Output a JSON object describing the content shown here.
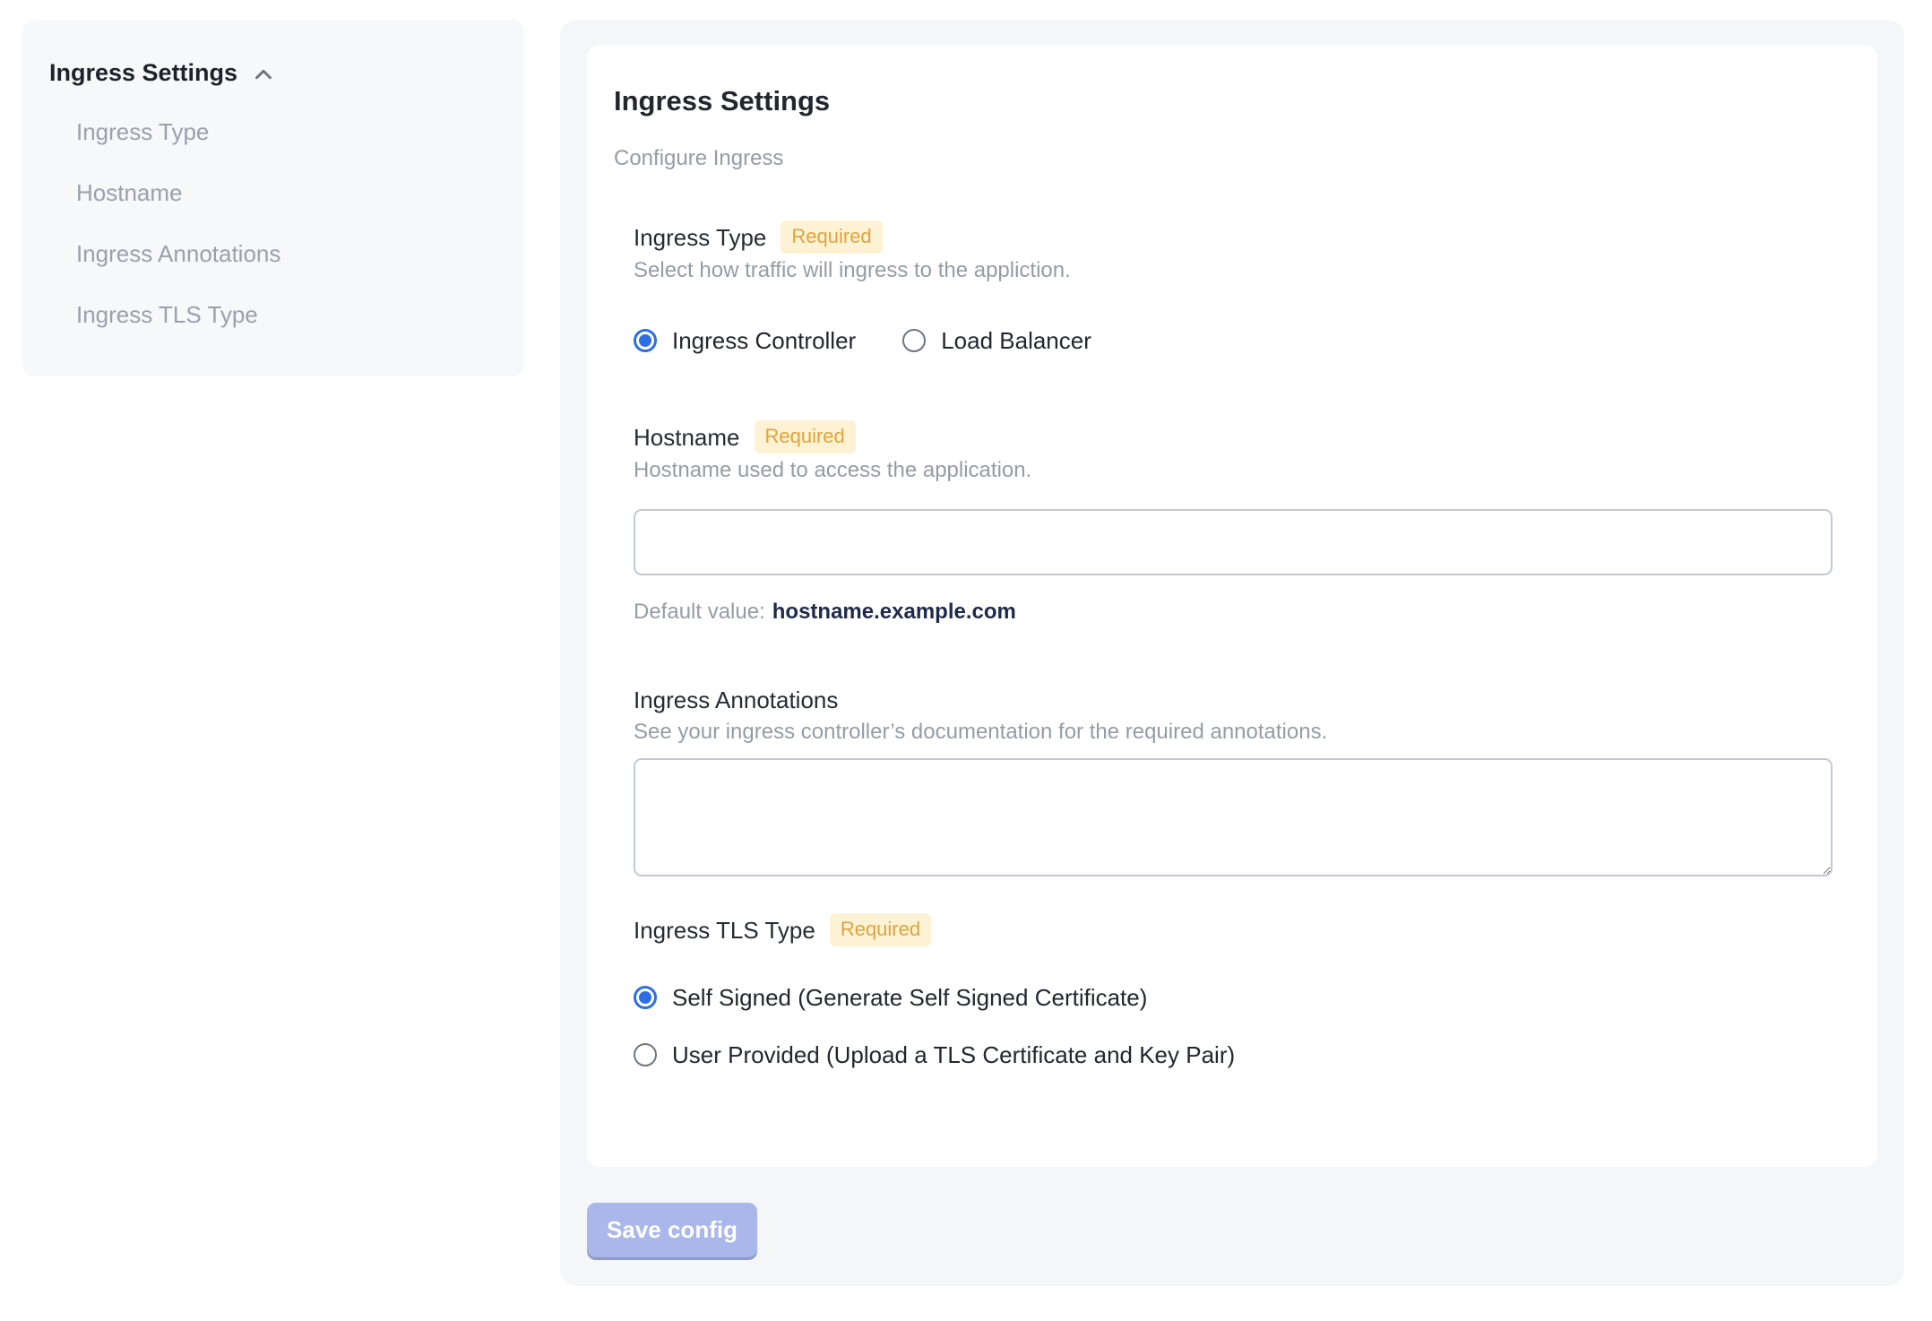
{
  "sidebar": {
    "header": "Ingress Settings",
    "items": [
      {
        "label": "Ingress Type"
      },
      {
        "label": "Hostname"
      },
      {
        "label": "Ingress Annotations"
      },
      {
        "label": "Ingress TLS Type"
      }
    ]
  },
  "panel": {
    "title": "Ingress Settings",
    "subtitle": "Configure Ingress",
    "sections": {
      "ingress_type": {
        "label": "Ingress Type",
        "required_badge": "Required",
        "description": "Select how traffic will ingress to the appliction.",
        "options": [
          {
            "label": "Ingress Controller",
            "selected": true
          },
          {
            "label": "Load Balancer",
            "selected": false
          }
        ]
      },
      "hostname": {
        "label": "Hostname",
        "required_badge": "Required",
        "description": "Hostname used to access the application.",
        "input_value": "",
        "default_value_label": "Default value:",
        "default_value": "hostname.example.com"
      },
      "ingress_annotations": {
        "label": "Ingress Annotations",
        "description": "See your ingress controller’s documentation for the required annotations.",
        "textarea_value": ""
      },
      "ingress_tls_type": {
        "label": "Ingress TLS Type",
        "required_badge": "Required",
        "options": [
          {
            "label": "Self Signed (Generate Self Signed Certificate)",
            "selected": true
          },
          {
            "label": "User Provided (Upload a TLS Certificate and Key Pair)",
            "selected": false
          }
        ]
      }
    },
    "save_button_label": "Save config"
  },
  "colors": {
    "accent_blue": "#2d6ee4",
    "badge_bg": "#fdf2d3",
    "badge_text": "#dfa43e",
    "save_button_bg": "#a9b7ea",
    "panel_bg": "#f5f6f8",
    "sidebar_bg": "#f7f8fa",
    "default_value_text": "#1e2a4a"
  }
}
